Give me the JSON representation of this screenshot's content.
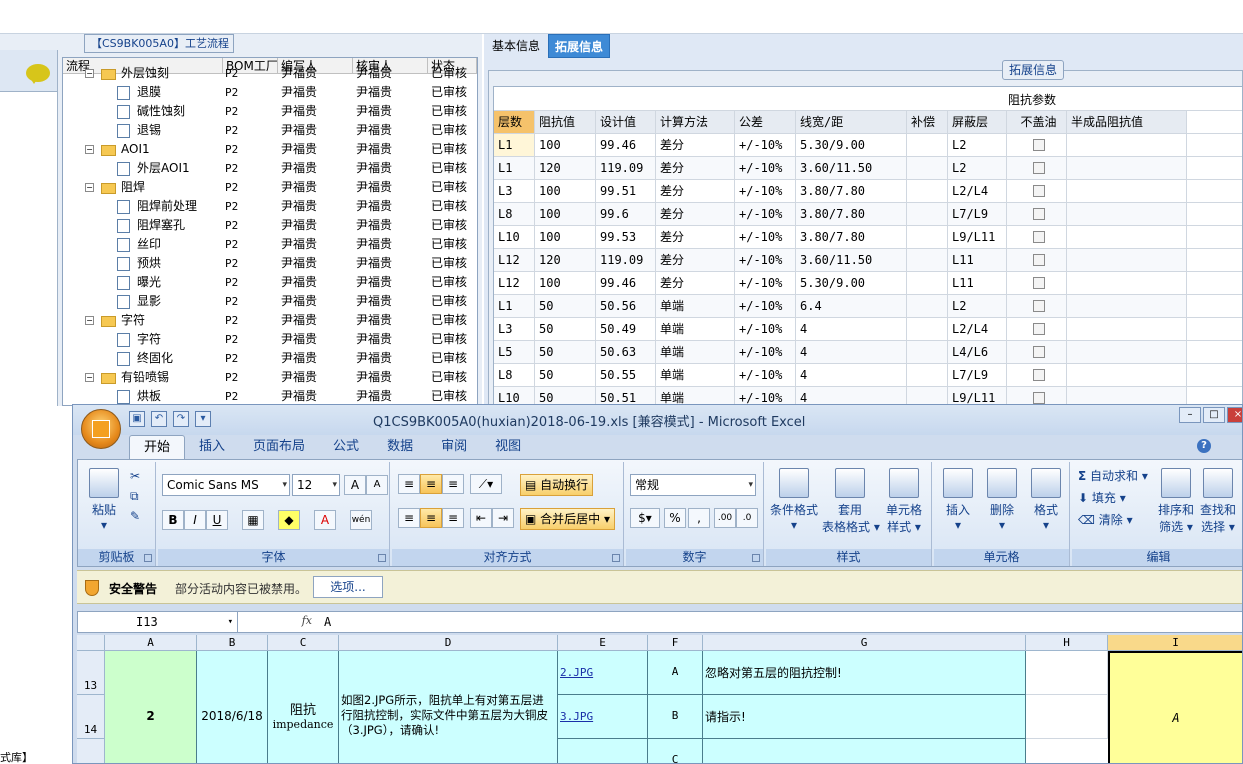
{
  "process_panel": {
    "caption": "【CS9BK005A0】工艺流程",
    "columns": [
      "流程",
      "BOM工厂",
      "编写人",
      "核审人",
      "状态"
    ],
    "rows": [
      {
        "level": 0,
        "type": "folder",
        "name": "外层蚀刻",
        "bom": "P2",
        "writer": "尹福贵",
        "reviewer": "尹福贵",
        "status": "已审核"
      },
      {
        "level": 1,
        "type": "doc",
        "name": "退膜",
        "bom": "P2",
        "writer": "尹福贵",
        "reviewer": "尹福贵",
        "status": "已审核"
      },
      {
        "level": 1,
        "type": "doc",
        "name": "碱性蚀刻",
        "bom": "P2",
        "writer": "尹福贵",
        "reviewer": "尹福贵",
        "status": "已审核"
      },
      {
        "level": 1,
        "type": "doc",
        "name": "退锡",
        "bom": "P2",
        "writer": "尹福贵",
        "reviewer": "尹福贵",
        "status": "已审核"
      },
      {
        "level": 0,
        "type": "folder",
        "name": "AOI1",
        "bom": "P2",
        "writer": "尹福贵",
        "reviewer": "尹福贵",
        "status": "已审核"
      },
      {
        "level": 1,
        "type": "doc",
        "name": "外层AOI1",
        "bom": "P2",
        "writer": "尹福贵",
        "reviewer": "尹福贵",
        "status": "已审核"
      },
      {
        "level": 0,
        "type": "folder",
        "name": "阻焊",
        "bom": "P2",
        "writer": "尹福贵",
        "reviewer": "尹福贵",
        "status": "已审核"
      },
      {
        "level": 1,
        "type": "doc",
        "name": "阻焊前处理",
        "bom": "P2",
        "writer": "尹福贵",
        "reviewer": "尹福贵",
        "status": "已审核"
      },
      {
        "level": 1,
        "type": "doc",
        "name": "阻焊塞孔",
        "bom": "P2",
        "writer": "尹福贵",
        "reviewer": "尹福贵",
        "status": "已审核"
      },
      {
        "level": 1,
        "type": "doc",
        "name": "丝印",
        "bom": "P2",
        "writer": "尹福贵",
        "reviewer": "尹福贵",
        "status": "已审核"
      },
      {
        "level": 1,
        "type": "doc",
        "name": "预烘",
        "bom": "P2",
        "writer": "尹福贵",
        "reviewer": "尹福贵",
        "status": "已审核"
      },
      {
        "level": 1,
        "type": "doc",
        "name": "曝光",
        "bom": "P2",
        "writer": "尹福贵",
        "reviewer": "尹福贵",
        "status": "已审核"
      },
      {
        "level": 1,
        "type": "doc",
        "name": "显影",
        "bom": "P2",
        "writer": "尹福贵",
        "reviewer": "尹福贵",
        "status": "已审核"
      },
      {
        "level": 0,
        "type": "folder",
        "name": "字符",
        "bom": "P2",
        "writer": "尹福贵",
        "reviewer": "尹福贵",
        "status": "已审核"
      },
      {
        "level": 1,
        "type": "doc",
        "name": "字符",
        "bom": "P2",
        "writer": "尹福贵",
        "reviewer": "尹福贵",
        "status": "已审核"
      },
      {
        "level": 1,
        "type": "doc",
        "name": "终固化",
        "bom": "P2",
        "writer": "尹福贵",
        "reviewer": "尹福贵",
        "status": "已审核"
      },
      {
        "level": 0,
        "type": "folder",
        "name": "有铅喷锡",
        "bom": "P2",
        "writer": "尹福贵",
        "reviewer": "尹福贵",
        "status": "已审核"
      },
      {
        "level": 1,
        "type": "doc",
        "name": "烘板",
        "bom": "P2",
        "writer": "尹福贵",
        "reviewer": "尹福贵",
        "status": "已审核"
      }
    ]
  },
  "right_tabs": [
    "基本信息",
    "拓展信息"
  ],
  "expand_caption": "拓展信息",
  "impedance": {
    "group_header": "阻抗参数",
    "columns": [
      "层数",
      "阻抗值",
      "设计值",
      "计算方法",
      "公差",
      "线宽/距",
      "补偿",
      "屏蔽层",
      "不盖油",
      "半成品阻抗值"
    ],
    "rows": [
      [
        "L1",
        "100",
        "99.46",
        "差分",
        "+/-10%",
        "5.30/9.00",
        "",
        "L2"
      ],
      [
        "L1",
        "120",
        "119.09",
        "差分",
        "+/-10%",
        "3.60/11.50",
        "",
        "L2"
      ],
      [
        "L3",
        "100",
        "99.51",
        "差分",
        "+/-10%",
        "3.80/7.80",
        "",
        "L2/L4"
      ],
      [
        "L8",
        "100",
        "99.6",
        "差分",
        "+/-10%",
        "3.80/7.80",
        "",
        "L7/L9"
      ],
      [
        "L10",
        "100",
        "99.53",
        "差分",
        "+/-10%",
        "3.80/7.80",
        "",
        "L9/L11"
      ],
      [
        "L12",
        "120",
        "119.09",
        "差分",
        "+/-10%",
        "3.60/11.50",
        "",
        "L11"
      ],
      [
        "L12",
        "100",
        "99.46",
        "差分",
        "+/-10%",
        "5.30/9.00",
        "",
        "L11"
      ],
      [
        "L1",
        "50",
        "50.56",
        "单端",
        "+/-10%",
        "6.4",
        "",
        "L2"
      ],
      [
        "L3",
        "50",
        "50.49",
        "单端",
        "+/-10%",
        "4",
        "",
        "L2/L4"
      ],
      [
        "L5",
        "50",
        "50.63",
        "单端",
        "+/-10%",
        "4",
        "",
        "L4/L6"
      ],
      [
        "L8",
        "50",
        "50.55",
        "单端",
        "+/-10%",
        "4",
        "",
        "L7/L9"
      ],
      [
        "L10",
        "50",
        "50.51",
        "单端",
        "+/-10%",
        "4",
        "",
        "L9/L11"
      ]
    ]
  },
  "excel": {
    "title": "Q1CS9BK005A0(huxian)2018-06-19.xls  [兼容模式] - Microsoft Excel",
    "tabs": [
      "开始",
      "插入",
      "页面布局",
      "公式",
      "数据",
      "审阅",
      "视图"
    ],
    "groups": {
      "clipboard": "剪贴板",
      "font": "字体",
      "align": "对齐方式",
      "number": "数字",
      "styles": "样式",
      "cells": "单元格",
      "editing": "编辑"
    },
    "paste_label": "粘贴",
    "font_name": "Comic Sans MS",
    "font_size": "12",
    "wrap_label": "自动换行",
    "merge_label": "合并后居中",
    "number_format": "常规",
    "cond_format": "条件格式",
    "table_format_1": "套用",
    "table_format_2": "表格格式",
    "cell_style_1": "单元格",
    "cell_style_2": "样式",
    "insert_label": "插入",
    "delete_label": "删除",
    "format_label": "格式",
    "autosum_label": "自动求和",
    "fill_label": "填充",
    "clear_label": "清除",
    "sort_1": "排序和",
    "sort_2": "筛选",
    "find_1": "查找和",
    "find_2": "选择",
    "security_title": "安全警告",
    "security_text": "部分活动内容已被禁用。",
    "options_label": "选项...",
    "name_box": "I13",
    "formula_value": "A",
    "columns": [
      "A",
      "B",
      "C",
      "D",
      "E",
      "F",
      "G",
      "H",
      "I"
    ],
    "rows": [
      "13",
      "14"
    ],
    "cells": {
      "a": "2",
      "b": "2018/6/18",
      "c1": "阻抗",
      "c2": "impedance",
      "d": "如图2.JPG所示，阻抗单上有对第五层进行阻抗控制，实际文件中第五层为大铜皮（3.JPG），请确认!",
      "e13": "2.JPG",
      "e14": "3.JPG",
      "f13": "A",
      "f14": "B",
      "f15": "C",
      "g13": "忽略对第五层的阻抗控制!",
      "g14": "请指示!",
      "i": "A"
    }
  },
  "footer_left": "式库】"
}
